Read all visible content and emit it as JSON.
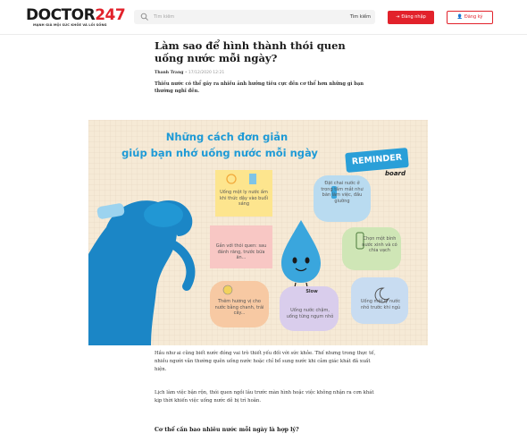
{
  "header": {
    "logo_main": "DOCTOR",
    "logo_number": "247",
    "logo_tagline": "MẠNH GIÀ MỘI SỨC KHỎE VÀ LỐI SỐNG",
    "search_placeholder": "Tìm kiếm",
    "search_button": "Tìm kiếm",
    "login_button": "Đăng nhập",
    "register_button": "Đăng ký"
  },
  "article": {
    "title": "Làm sao để hình thành thói quen uống nước mỗi ngày?",
    "author": "Thanh Trang",
    "date": "17/12/2020 12:21",
    "sapo": "Thiếu nước có thể gây ra nhiều ảnh hưởng tiêu cực đến cơ thể hơn những gì bạn thường nghĩ đến.",
    "paragraph_1": "Hầu như ai cũng biết nước đóng vai trò thiết yếu đối với sức khỏe. Thế nhưng trong thực tế, nhiều người vẫn thường quên uống nước hoặc chỉ bổ sung nước khi cảm giác khát đã xuất hiện.",
    "paragraph_2": "Lịch làm việc bận rộn, thói quen ngồi lâu trước màn hình hoặc việc không nhận ra cơn khát kịp thời khiến việc uống nước dễ bị trì hoãn.",
    "heading_2": "Cơ thể cần bao nhiêu nước mỗi ngày là hợp lý?"
  },
  "infographic": {
    "title_line_1": "Những cách đơn giản",
    "title_line_2": "giúp bạn nhớ uống nước mỗi ngày",
    "reminder": "REMINDER",
    "board": "board",
    "tips": [
      "Uống một ly nước ấm khi thức dậy vào buổi sáng",
      "Đặt chai nước ở trong tầm mắt như bàn làm việc, đầu giường",
      "Gắn với thói quen: sau đánh răng, trước bữa ăn...",
      "Chọn một bình nước xinh và có chia vạch",
      "Thêm hương vị cho nước bằng chanh, trái cây...",
      "Uống nước chậm, uống từng ngụm nhỏ",
      "Uống một ly nước nhỏ trước khi ngủ"
    ],
    "slow_label": "Slow",
    "colors": {
      "background": "#f6ead6",
      "blue": "#1e9ad6",
      "yellow": "#fde58e",
      "blue_note": "#b9dbf0",
      "pink": "#f8c7c4",
      "green": "#cfe6b6",
      "orange": "#f7c9a3",
      "lavender": "#d9cdec",
      "light_blue": "#c8dcf1"
    }
  },
  "colors": {
    "brand_red": "#e2222b"
  }
}
